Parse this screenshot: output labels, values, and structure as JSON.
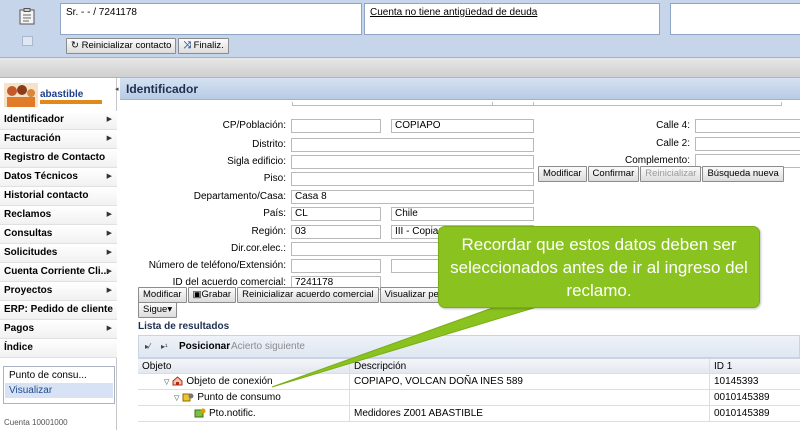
{
  "header": {
    "box1_text": "Sr. - - / 7241178",
    "box2_text": "Cuenta no tiene antigüedad de deuda",
    "reset_contact_label": "Reinicializar contacto",
    "finalize_label": "Finaliz."
  },
  "nav": {
    "logo_text": "abastible",
    "items": [
      {
        "label": "Identificador",
        "arrow": true
      },
      {
        "label": "Facturación",
        "arrow": true
      },
      {
        "label": "Registro de Contacto",
        "arrow": false
      },
      {
        "label": "Datos Técnicos",
        "arrow": true
      },
      {
        "label": "Historial contacto",
        "arrow": false
      },
      {
        "label": "Reclamos",
        "arrow": true
      },
      {
        "label": "Consultas",
        "arrow": true
      },
      {
        "label": "Solicitudes",
        "arrow": true
      },
      {
        "label": "Cuenta Corriente Cli...",
        "arrow": true
      },
      {
        "label": "Proyectos",
        "arrow": true
      },
      {
        "label": "ERP: Pedido de cliente",
        "arrow": false
      },
      {
        "label": "Pagos",
        "arrow": true
      },
      {
        "label": "Índice",
        "arrow": false
      }
    ],
    "box_title": "Punto de consu...",
    "box_link": "Visualizar",
    "bottom_text": "Cuenta 10001000"
  },
  "main": {
    "title": "Identificador",
    "fields": {
      "cp_label": "CP/Población:",
      "cp_value": "",
      "city_value": "COPIAPO",
      "distrito_label": "Distrito:",
      "sigla_label": "Sigla edificio:",
      "piso_label": "Piso:",
      "depto_label": "Departamento/Casa:",
      "depto_value": "Casa 8",
      "pais_label": "País:",
      "pais_code": "CL",
      "pais_name": "Chile",
      "region_label": "Región:",
      "region_code": "03",
      "region_name": "III - Copiapo",
      "email_label": "Dir.cor.elec.:",
      "tel_label": "Número de teléfono/Extensión:",
      "acuerdo_label": "ID del acuerdo comercial:",
      "acuerdo_value": "7241178",
      "calle4_label": "Calle 4:",
      "calle2_label": "Calle 2:",
      "complemento_label": "Complemento:"
    },
    "right_buttons": {
      "modificar": "Modificar",
      "confirmar": "Confirmar",
      "reinicializar": "Reinicializar",
      "busqueda": "Búsqueda nueva"
    },
    "bottom_buttons": {
      "modificar": "Modificar",
      "grabar": "Grabar",
      "reinicializar_acuerdo": "Reinicializar acuerdo comercial",
      "visualizar": "Visualizar pers",
      "sigue": "Sigue"
    },
    "results": {
      "title": "Lista de resultados",
      "posicionar": "Posicionar",
      "acierto": "Acierto siguiente",
      "col_objeto": "Objeto",
      "col_descripcion": "Descripción",
      "col_id": "ID 1",
      "rows": [
        {
          "objeto": "Objeto de conexión",
          "descripcion": "COPIAPO, VOLCAN DOÑA INES 589",
          "id": "10145393"
        },
        {
          "objeto": "Punto de consumo",
          "descripcion": "",
          "id": "0010145389"
        },
        {
          "objeto": "Pto.notific.",
          "descripcion": "Medidores Z001 ABASTIBLE",
          "id": "0010145389"
        }
      ]
    }
  },
  "callout": {
    "text": "Recordar que estos datos deben ser seleccionados antes de ir al ingreso del reclamo.",
    "color": "#8ac31f"
  }
}
